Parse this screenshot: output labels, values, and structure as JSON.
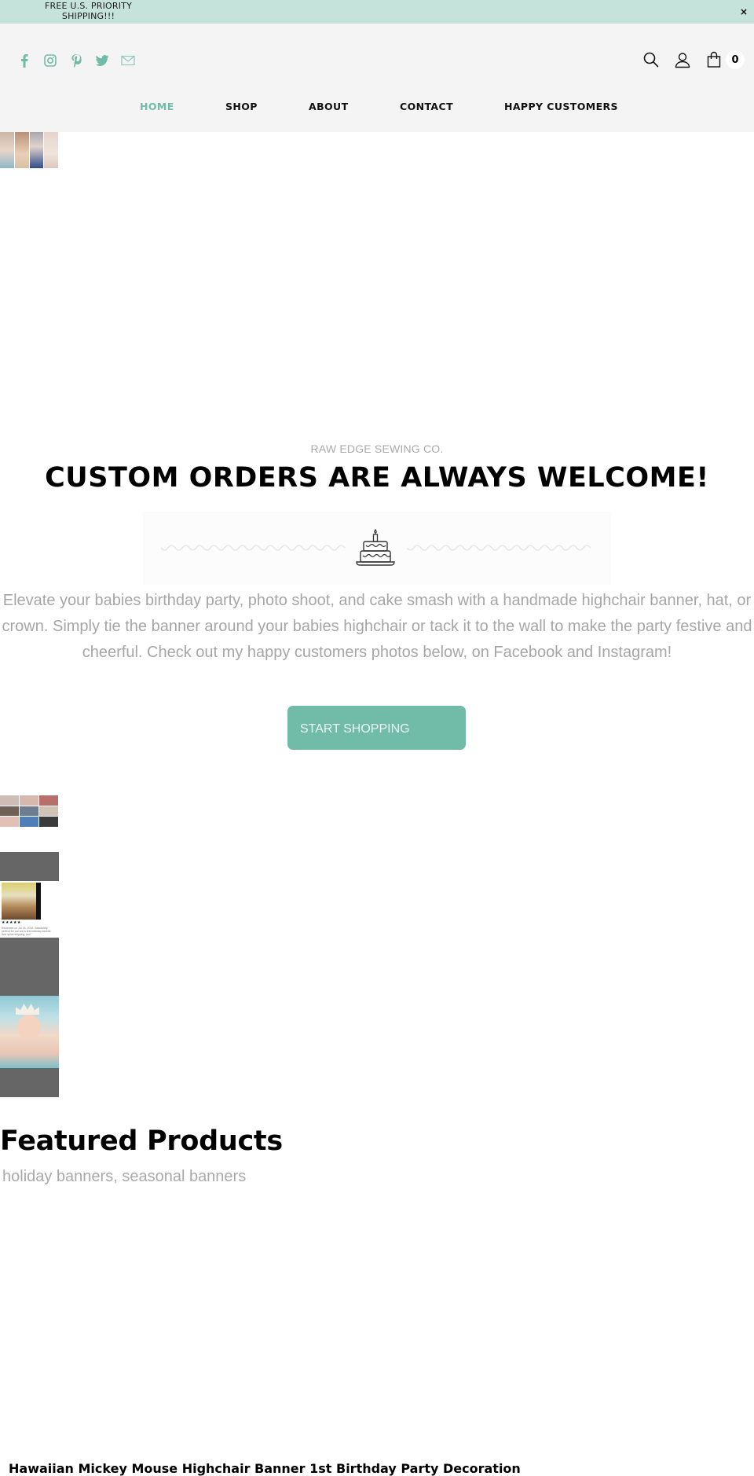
{
  "announcement": {
    "text": "FREE U.S. PRIORITY SHIPPING!!!",
    "close_label": "×"
  },
  "colors": {
    "accent": "#71bba9",
    "announce_bg": "#c6e3db",
    "header_bg": "#f4f4f4",
    "muted_text": "#a6a6a6"
  },
  "header": {
    "social": [
      {
        "name": "facebook",
        "icon": "facebook-icon"
      },
      {
        "name": "instagram",
        "icon": "instagram-icon"
      },
      {
        "name": "pinterest",
        "icon": "pinterest-icon"
      },
      {
        "name": "twitter",
        "icon": "twitter-icon"
      },
      {
        "name": "email",
        "icon": "mail-icon"
      }
    ],
    "tools": {
      "search_icon": "search-icon",
      "account_icon": "user-icon",
      "cart_icon": "shopping-bag-icon",
      "cart_count": "0"
    }
  },
  "nav": {
    "items": [
      {
        "label": "HOME",
        "active": true
      },
      {
        "label": "SHOP",
        "active": false
      },
      {
        "label": "ABOUT",
        "active": false
      },
      {
        "label": "CONTACT",
        "active": false
      },
      {
        "label": "HAPPY CUSTOMERS",
        "active": false
      }
    ]
  },
  "hero": {
    "brand": "RAW EDGE SEWING CO.",
    "headline": "CUSTOM ORDERS ARE ALWAYS WELCOME!",
    "divider_icon": "birthday-cake-icon",
    "intro": "Elevate your babies birthday party, photo shoot, and cake smash with a handmade highchair banner, hat, or crown.  Simply tie the banner around your babies highchair or tack it to the wall to make the party festive and cheerful.  Check out my happy customers photos below, on Facebook and Instagram!",
    "cta_label": "START SHOPPING"
  },
  "gallery": {
    "review": {
      "stars": "★★★★★",
      "rating": 5,
      "text": "Reviewed on Jul 25, 2018 \"Absolutely perfect for our son's first birthday banner. And quick shipping, too!\""
    }
  },
  "featured": {
    "title": "Featured Products",
    "subtitle": "holiday banners, seasonal banners",
    "products": [
      {
        "title": "Hawaiian Mickey Mouse Highchair Banner 1st Birthday Party Decoration"
      }
    ]
  }
}
